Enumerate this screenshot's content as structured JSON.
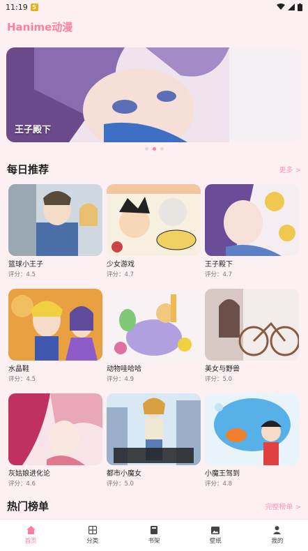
{
  "status": {
    "time": "11:19",
    "badge": "5"
  },
  "app": {
    "title": "Hanime动漫"
  },
  "banner": {
    "caption": "王子殿下"
  },
  "daily": {
    "title": "每日推荐",
    "more": "更多 >"
  },
  "items": [
    {
      "title": "篮球小王子",
      "score": "评分：4.5"
    },
    {
      "title": "少女游戏",
      "score": "评分：4.7"
    },
    {
      "title": "王子殿下",
      "score": "评分：4.7"
    },
    {
      "title": "水晶鞋",
      "score": "评分：4.5"
    },
    {
      "title": "动物哇哈哈",
      "score": "评分：4.9"
    },
    {
      "title": "美女与野兽",
      "score": "评分：5.0"
    },
    {
      "title": "灰姑娘进化论",
      "score": "评分：4.6"
    },
    {
      "title": "都市小魔女",
      "score": "评分：5.0"
    },
    {
      "title": "小魔王驾到",
      "score": "评分：4.8"
    }
  ],
  "hot": {
    "title": "热门榜单",
    "more": "完整榜单 >"
  },
  "tabs": [
    {
      "label": "首页",
      "icon": "home-icon"
    },
    {
      "label": "分类",
      "icon": "grid-icon"
    },
    {
      "label": "书架",
      "icon": "book-icon"
    },
    {
      "label": "壁纸",
      "icon": "image-icon"
    },
    {
      "label": "我的",
      "icon": "user-icon"
    }
  ],
  "colors": {
    "accent": "#ff7fa0",
    "background": "#fdf0f3"
  }
}
